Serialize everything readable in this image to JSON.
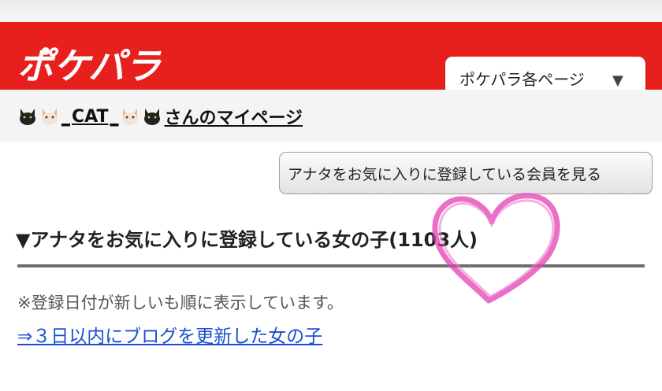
{
  "header": {
    "logo_text": "ポケパラ",
    "brand_color": "#e8201d",
    "pages_menu": {
      "label": "ポケパラ各ページ",
      "arrow_icon": "▼"
    }
  },
  "mypage": {
    "cat_left_icons": [
      "black-cat-icon",
      "white-cat-icon"
    ],
    "separator_left": "_",
    "username": "CAT",
    "separator_right": "_",
    "cat_right_icons": [
      "white-cat-icon",
      "black-cat-icon"
    ],
    "suffix": "さんのマイページ"
  },
  "favorites_button": {
    "label": "アナタをお気に入りに登録している会員を見る"
  },
  "section": {
    "heading": "▼アナタをお気に入りに登録している女の子(1103人)"
  },
  "notice": "※登録日付が新しいも順に表示しています。",
  "blog_link": "⇒３日以内にブログを更新した女の子",
  "decoration": {
    "heart_color": "#e23fb4"
  }
}
